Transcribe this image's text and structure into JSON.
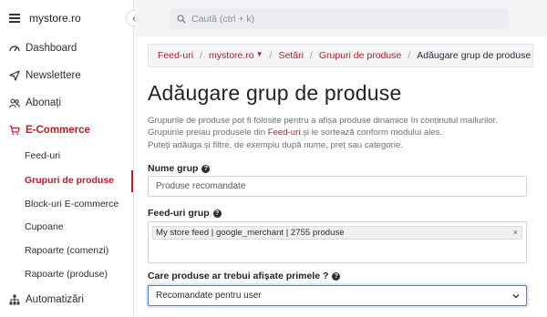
{
  "sidebar": {
    "brand": "mystore.ro",
    "items": [
      {
        "label": "Dashboard",
        "icon": "dashboard-icon"
      },
      {
        "label": "Newslettere",
        "icon": "send-icon"
      },
      {
        "label": "Abonați",
        "icon": "users-icon"
      },
      {
        "label": "E-Commerce",
        "icon": "cart-icon"
      }
    ],
    "sub_items": [
      {
        "label": "Feed-uri"
      },
      {
        "label": "Grupuri de produse"
      },
      {
        "label": "Block-uri E-commerce"
      },
      {
        "label": "Cupoane"
      },
      {
        "label": "Rapoarte (comenzi)"
      },
      {
        "label": "Rapoarte (produse)"
      }
    ],
    "automation": {
      "label": "Automatizări",
      "icon": "sitemap-icon"
    },
    "collapse_glyph": "‹",
    "accent_color": "#b21f2d"
  },
  "search": {
    "placeholder": "Caută (ctrl + k)"
  },
  "breadcrumb": {
    "items": [
      "Feed-uri",
      "mystore.ro",
      "Setări",
      "Grupuri de produse"
    ],
    "current": "Adăugare grup de produse",
    "caret": "▼",
    "separator": "/"
  },
  "page": {
    "title": "Adăugare grup de produse",
    "desc_line1": "Grupurile de produse pot fi folosite pentru a afișa produse dinamice în conținutul mailurilor.",
    "desc_line2_a": "Grupurile preiau produsele din ",
    "desc_line2_link": "Feed-uri",
    "desc_line2_b": " și le sortează conform modului ales.",
    "desc_line3": "Puteți adăuga și filtre, de exemplu după nume, preț sau categorie."
  },
  "form": {
    "name_label": "Nume grup",
    "name_value": "Produse recomandate",
    "feeds_label": "Feed-uri grup",
    "feed_tag": "My store feed | google_merchant | 2755 produse",
    "tag_remove": "×",
    "order_label": "Care produse ar trebui afișate primele ?",
    "order_value": "Recomandate pentru user",
    "help_glyph": "?"
  }
}
